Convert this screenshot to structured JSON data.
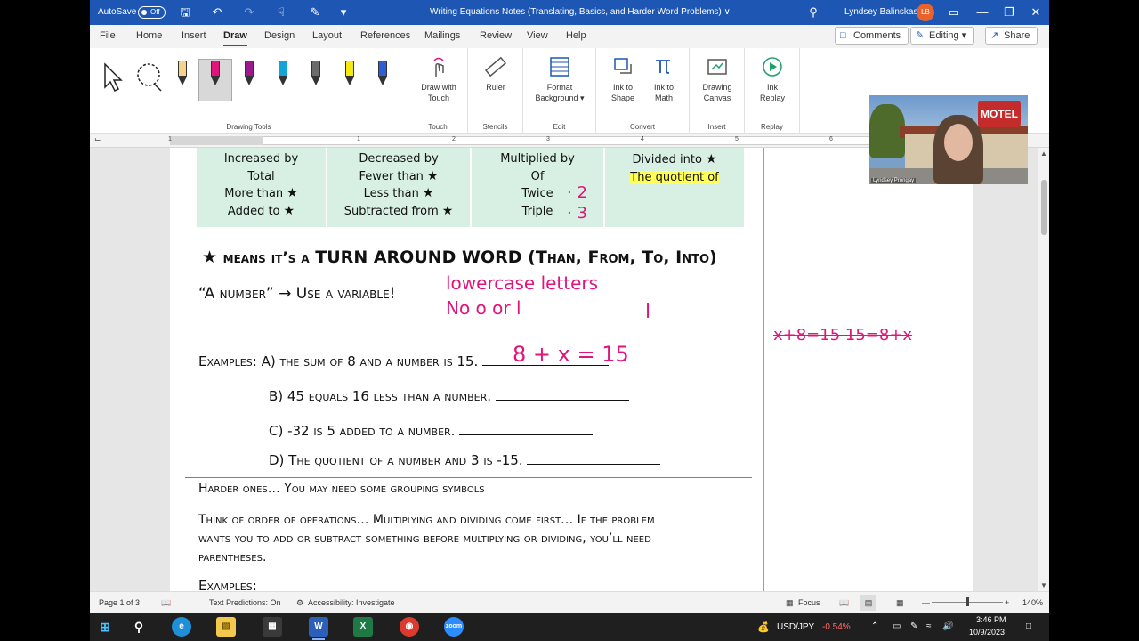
{
  "titlebar": {
    "autosave_label": "AutoSave",
    "autosave_state": "Off",
    "document_title": "Writing Equations Notes (Translating, Basics, and Harder Word Problems) ∨",
    "user_name": "Lyndsey Balinskas",
    "user_initials": "LB"
  },
  "menu": {
    "items": [
      "File",
      "Home",
      "Insert",
      "Draw",
      "Design",
      "Layout",
      "References",
      "Mailings",
      "Review",
      "View",
      "Help"
    ],
    "active": "Draw",
    "comments_label": "Comments",
    "editing_label": "Editing",
    "share_label": "Share"
  },
  "ribbon": {
    "drawing_tools_label": "Drawing Tools",
    "touch": {
      "button": "Draw with Touch",
      "group": "Touch"
    },
    "stencils": {
      "button": "Ruler",
      "group": "Stencils"
    },
    "edit": {
      "button": "Format Background",
      "group": "Edit"
    },
    "convert": {
      "button1": "Ink to Shape",
      "button2": "Ink to Math",
      "group": "Convert"
    },
    "insert": {
      "button": "Drawing Canvas",
      "group": "Insert"
    },
    "replay": {
      "button": "Ink Replay",
      "group": "Replay"
    },
    "pens": [
      {
        "name": "pencil",
        "color": "#f5d38a"
      },
      {
        "name": "pen-pink",
        "color": "#e0147a"
      },
      {
        "name": "pen-purple",
        "color": "#9b1a8e"
      },
      {
        "name": "pen-cyan",
        "color": "#12a3d9"
      },
      {
        "name": "pen-gray",
        "color": "#6b6b6b"
      },
      {
        "name": "highlighter-yellow",
        "color": "#f4ea12"
      },
      {
        "name": "pen-galaxy",
        "color": "#2c5fd4"
      }
    ]
  },
  "ruler": {
    "marks": [
      "1",
      "1",
      "2",
      "3",
      "4",
      "5",
      "6"
    ]
  },
  "document": {
    "table": {
      "col1": [
        "Increased by",
        "Total",
        "More than",
        "Added to"
      ],
      "col2": [
        "Decreased by",
        "Fewer than",
        "Less than",
        "Subtracted from"
      ],
      "col3": [
        "Multiplied by",
        "Of",
        "Twice",
        "Triple"
      ],
      "col4": [
        "Divided into",
        "The quotient of"
      ]
    },
    "heading": {
      "star": "★",
      "part1": "means it’s a",
      "part2": "TURN AROUND WORD",
      "part3": "(Than, From, To, Into)"
    },
    "a_number": "“A number” → Use a variable!",
    "examples_label": "Examples:",
    "example_a": "A)  the sum of 8 and a number is 15.",
    "example_b": "B) 45 equals 16 less than a number.",
    "example_c": "C)  -32 is 5 added to a number.",
    "example_d": "D) The quotient of a number and 3 is -15.",
    "harder": "Harder ones…  You may need some grouping symbols",
    "think_line1": "Think of order of operations… Multiplying and dividing come first… If the problem",
    "think_line2": "wants you to add or subtract something before multiplying or dividing, you’ll need",
    "think_line3": "parentheses.",
    "examples2_label": "Examples:"
  },
  "handwriting": {
    "lowercase": "lowercase letters",
    "no_o_or_l": "No o or l",
    "l_mark": "l",
    "twice_mark": "· 2",
    "triple_mark": "· 3",
    "answer_a": "8 + x = 15",
    "margin_note": "x+8=15   15=8+x"
  },
  "webcam": {
    "name": "Lyndsey Prongay",
    "sign": "MOTEL"
  },
  "statusbar": {
    "page": "Page 1 of 3",
    "text_predictions": "Text Predictions: On",
    "accessibility": "Accessibility: Investigate",
    "focus": "Focus",
    "zoom": "140%"
  },
  "taskbar": {
    "ticker": "USD/JPY",
    "change": "-0.54%",
    "time": "3:46 PM",
    "date": "10/9/2023"
  }
}
